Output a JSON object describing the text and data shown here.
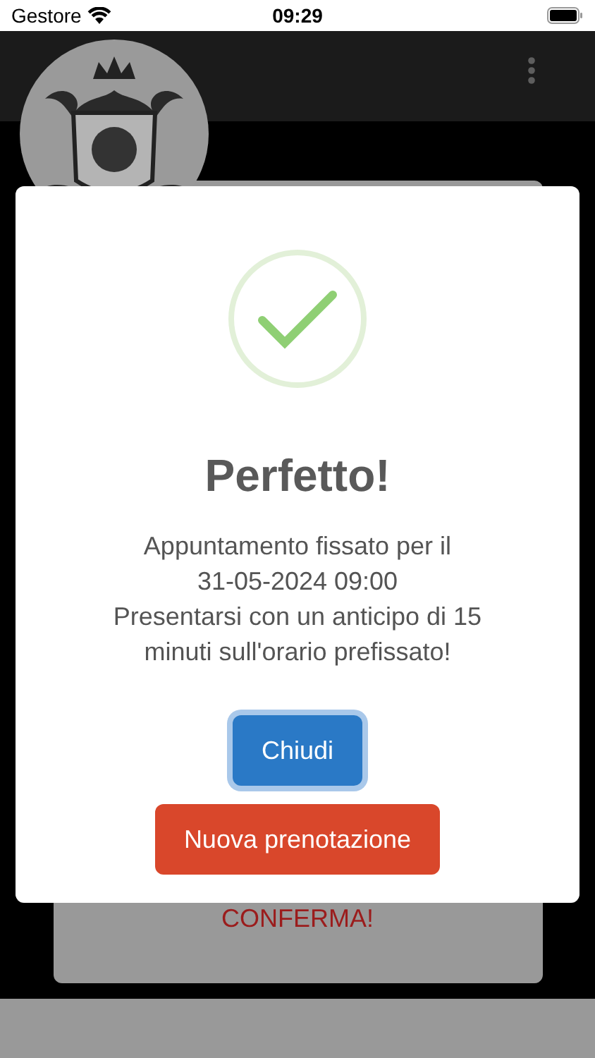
{
  "status_bar": {
    "carrier": "Gestore",
    "time": "09:29"
  },
  "background": {
    "card_button": "CONFERMA!"
  },
  "dialog": {
    "title": "Perfetto!",
    "message_lines": [
      "Appuntamento fissato per il",
      "31-05-2024 09:00",
      "Presentarsi con un anticipo di 15",
      "minuti sull'orario prefissato!"
    ],
    "buttons": [
      {
        "label": "Chiudi",
        "kind": "primary"
      },
      {
        "label": "Nuova prenotazione",
        "kind": "danger"
      }
    ]
  }
}
